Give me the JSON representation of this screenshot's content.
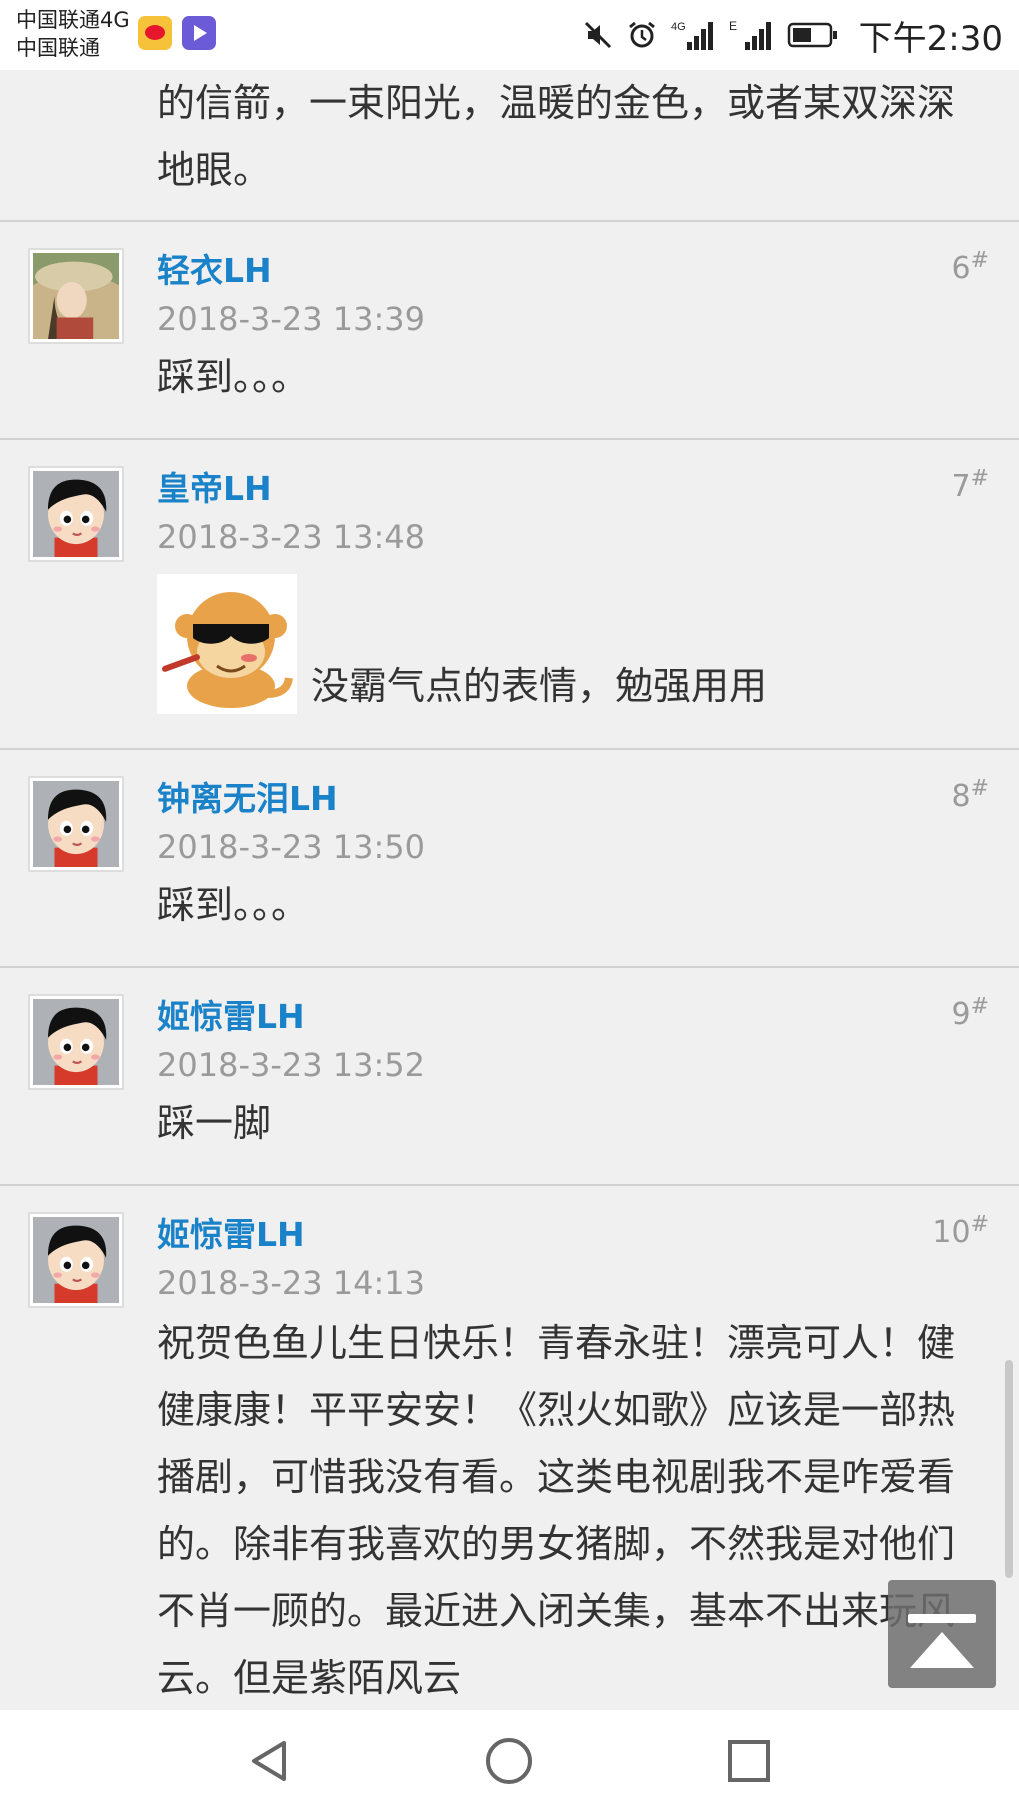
{
  "status_bar": {
    "carrier_line1": "中国联通4G",
    "carrier_line2": "中国联通",
    "time": "下午2:30",
    "network_label": "4G",
    "edge_label": "E"
  },
  "partial_comment": {
    "text": "的信箭，一束阳光，温暖的金色，或者某双深深地眼。"
  },
  "comments": [
    {
      "username": "轻衣LH",
      "time": "2018-3-23 13:39",
      "floor": "6",
      "text": "踩到。。。"
    },
    {
      "username": "皇帝LH",
      "time": "2018-3-23 13:48",
      "floor": "7",
      "text": "没霸气点的表情，勉强用用"
    },
    {
      "username": "钟离无泪LH",
      "time": "2018-3-23 13:50",
      "floor": "8",
      "text": "踩到。。。"
    },
    {
      "username": "姬惊雷LH",
      "time": "2018-3-23 13:52",
      "floor": "9",
      "text": "踩一脚"
    },
    {
      "username": "姬惊雷LH",
      "time": "2018-3-23 14:13",
      "floor": "10",
      "text": "祝贺色鱼儿生日快乐！青春永驻！漂亮可人！健健康康！平平安安！《烈火如歌》应该是一部热播剧，可惜我没有看。这类电视剧我不是咋爱看的。除非有我喜欢的男女猪脚，不然我是对他们不肖一顾的。最近进入闭关集，基本不出来玩风云。但是紫陌风云"
    }
  ],
  "floor_mark": "#",
  "colors": {
    "username": "#1a82c8",
    "timestamp": "#9a9a9a",
    "background": "#f0f0f0"
  }
}
